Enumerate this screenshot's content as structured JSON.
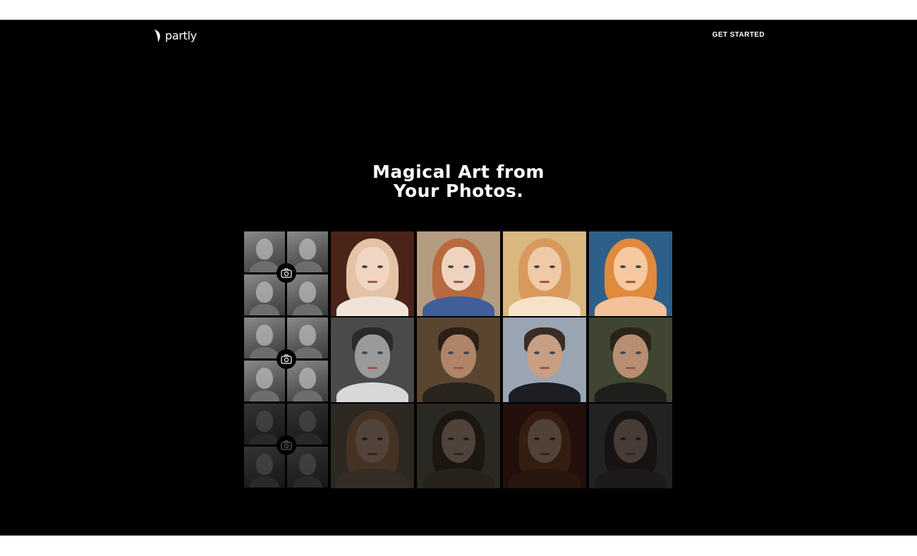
{
  "nav": {
    "logo_text": "partly",
    "logo_icon": "leaf-icon",
    "cta_label": "GET STARTED"
  },
  "hero": {
    "title_line1": "Magical Art from",
    "title_line2": "Your Photos."
  },
  "icons": {
    "camera": "camera-icon"
  },
  "colors": {
    "background": "#000000",
    "text": "#ffffff",
    "page_margin": "#ffffff"
  },
  "gallery": {
    "rows": [
      {
        "subject": "woman",
        "source_photos": 4,
        "results": [
          {
            "bg": "#4a2418",
            "hair": "#e3c2a6",
            "skin": "#f1d5c3",
            "body": "#efe3da"
          },
          {
            "bg": "#b59b80",
            "hair": "#b86a3e",
            "skin": "#efd3bf",
            "body": "#3f5e9a"
          },
          {
            "bg": "#d9b77e",
            "hair": "#d89a5c",
            "skin": "#f0c9a6",
            "body": "#f5e2c8"
          },
          {
            "bg": "#2d5f8a",
            "hair": "#e08a3e",
            "skin": "#f6c9a1",
            "body": "#f3c29a"
          }
        ]
      },
      {
        "subject": "man",
        "source_photos": 4,
        "results": [
          {
            "bg": "#4a4a4a",
            "hair": "#2a2a2a",
            "skin": "#9a9a9a",
            "body": "#d8d8d8"
          },
          {
            "bg": "#5a4630",
            "hair": "#2b2016",
            "skin": "#b08468",
            "body": "#2a241e"
          },
          {
            "bg": "#9aa5b3",
            "hair": "#3a2c22",
            "skin": "#c89e84",
            "body": "#1e1e22"
          },
          {
            "bg": "#3f4530",
            "hair": "#2a2218",
            "skin": "#b88e72",
            "body": "#1e1e1c"
          }
        ]
      },
      {
        "subject": "woman",
        "source_photos": 4,
        "results": [
          {
            "bg": "#7a6b5e",
            "hair": "#b5855a",
            "skin": "#d8b198",
            "body": "#8a7462"
          },
          {
            "bg": "#6d6a5c",
            "hair": "#4a3a2a",
            "skin": "#cfae96",
            "body": "#6a5a4a"
          },
          {
            "bg": "#5e2c20",
            "hair": "#8a4a2a",
            "skin": "#d6ad92",
            "body": "#6a3a28"
          },
          {
            "bg": "#5a5a5a",
            "hair": "#3a3230",
            "skin": "#b89c8c",
            "body": "#4a4444"
          }
        ]
      }
    ]
  }
}
